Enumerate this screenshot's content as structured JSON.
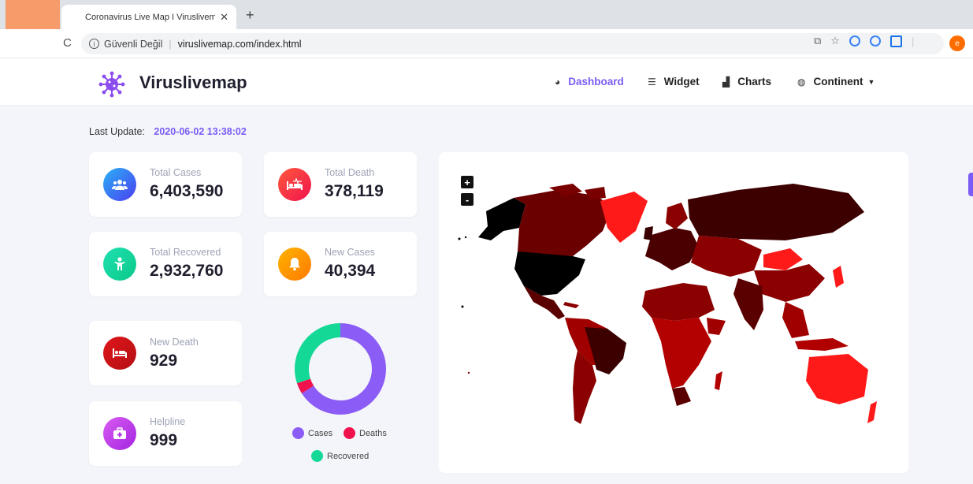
{
  "browser": {
    "tab_title": "Coronavirus Live Map I Viruslivemap",
    "tab_close": "✕",
    "new_tab": "+",
    "reload": "C",
    "security_label": "Güvenli Değil",
    "url": "viruslivemap.com/index.html",
    "profile_initial": "e"
  },
  "header": {
    "brand": "Viruslivemap",
    "nav": [
      {
        "label": "Dashboard",
        "icon": "dashboard-icon"
      },
      {
        "label": "Widget",
        "icon": "layers-icon"
      },
      {
        "label": "Charts",
        "icon": "area-chart-icon"
      },
      {
        "label": "Continent",
        "icon": "globe-icon"
      }
    ],
    "accent": "#7b5cf5"
  },
  "last_update": {
    "label": "Last Update:",
    "value": "2020-06-02 13:38:02"
  },
  "stats": [
    {
      "label": "Total Cases",
      "value": "6,403,590",
      "icon": "users-icon",
      "color": "#3b5bf6"
    },
    {
      "label": "Total Death",
      "value": "378,119",
      "icon": "bed-pulse-icon",
      "color": "#f5243a"
    },
    {
      "label": "Total Recovered",
      "value": "2,932,760",
      "icon": "person-icon",
      "color": "#14d3a2"
    },
    {
      "label": "New Cases",
      "value": "40,394",
      "icon": "bell-icon",
      "color": "#ffa000"
    },
    {
      "label": "New Death",
      "value": "929",
      "icon": "bed-icon",
      "color": "#d31619"
    },
    {
      "label": "Helpline",
      "value": "999",
      "icon": "medkit-icon",
      "color": "#c43ee8"
    }
  ],
  "donut": {
    "legend": [
      {
        "label": "Cases",
        "color": "#8b5cf6"
      },
      {
        "label": "Deaths",
        "color": "#f0124d"
      },
      {
        "label": "Recovered",
        "color": "#14d896"
      }
    ]
  },
  "chart_data": {
    "type": "pie",
    "labels": [
      "Cases",
      "Deaths",
      "Recovered"
    ],
    "values": [
      6403590,
      378119,
      2932760
    ],
    "colors": [
      "#8b5cf6",
      "#f0124d",
      "#14d896"
    ]
  },
  "map": {
    "zoom_in": "+",
    "zoom_out": "-"
  }
}
